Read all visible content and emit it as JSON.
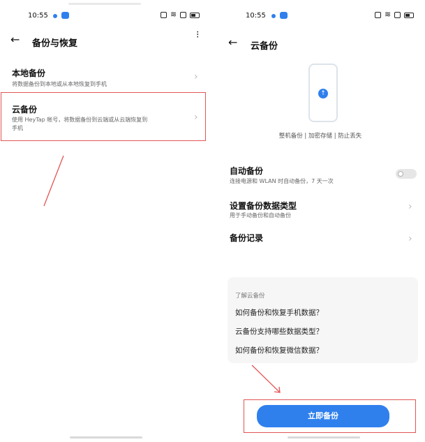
{
  "left": {
    "status": {
      "time": "10:55"
    },
    "header": {
      "title": "备份与恢复"
    },
    "items": [
      {
        "title": "本地备份",
        "subtitle": "将数据备份到本地或从本地恢复到手机"
      },
      {
        "title": "云备份",
        "subtitle_line1": "使用 HeyTap 帐号，将数据备份到云端或从云端恢复到",
        "subtitle_line2": "手机"
      }
    ]
  },
  "right": {
    "status": {
      "time": "10:55"
    },
    "header": {
      "title": "云备份"
    },
    "hero_caption": "整机备份 | 加密存储 | 防止丢失",
    "settings": [
      {
        "title": "自动备份",
        "subtitle": "连接电源和 WLAN 时自动备份，7 天一次"
      },
      {
        "title": "设置备份数据类型",
        "subtitle": "用于手动备份和自动备份"
      },
      {
        "title": "备份记录"
      }
    ],
    "faq": {
      "heading": "了解云备份",
      "questions": [
        "如何备份和恢复手机数据？",
        "云备份支持哪些数据类型？",
        "如何备份和恢复微信数据？"
      ]
    },
    "primary_button": "立即备份"
  },
  "colors": {
    "accent": "#2f80ed",
    "annotation": "#e25555"
  }
}
